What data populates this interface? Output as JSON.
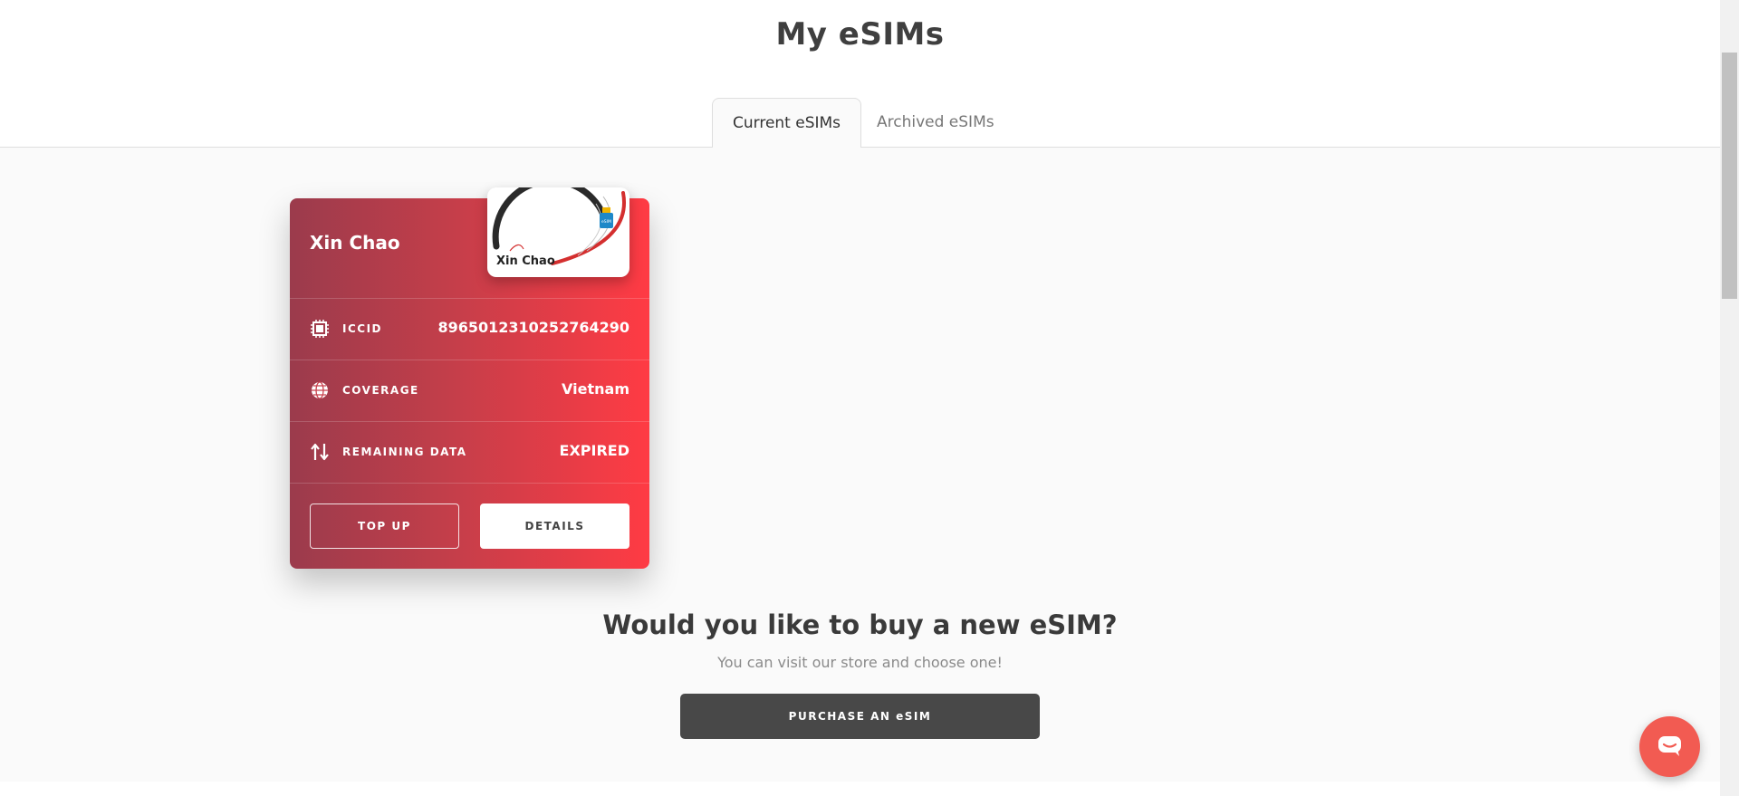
{
  "page": {
    "title": "My eSIMs"
  },
  "tabs": [
    {
      "label": "Current eSIMs",
      "active": true
    },
    {
      "label": "Archived eSIMs",
      "active": false
    }
  ],
  "esim": {
    "name": "Xin Chao",
    "logo_text": "Xin Chao",
    "logo_chip_text": "eSIM",
    "rows": {
      "iccid": {
        "label": "ICCID",
        "value": "8965012310252764290",
        "icon": "chip-icon"
      },
      "coverage": {
        "label": "COVERAGE",
        "value": "Vietnam",
        "icon": "globe-icon"
      },
      "remaining": {
        "label": "REMAINING DATA",
        "value": "EXPIRED",
        "icon": "data-arrows-icon"
      }
    },
    "buttons": {
      "top_up": "TOP UP",
      "details": "DETAILS"
    }
  },
  "promo": {
    "heading": "Would you like to buy a new eSIM?",
    "subtext": "You can visit our store and choose one!",
    "button": "PURCHASE AN eSIM"
  },
  "chat": {
    "icon": "chat-icon"
  },
  "colors": {
    "card_gradient_start": "#9b3b4c",
    "card_gradient_end": "#ff3b44",
    "purchase_button": "#484848",
    "chat_bubble": "#f25b52"
  }
}
